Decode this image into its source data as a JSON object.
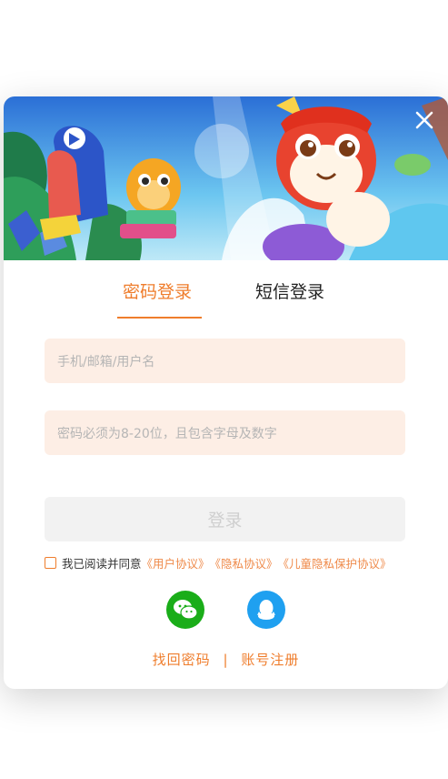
{
  "tabs": [
    {
      "label": "密码登录",
      "active": true
    },
    {
      "label": "短信登录",
      "active": false
    }
  ],
  "fields": {
    "username_placeholder": "手机/邮箱/用户名",
    "password_placeholder": "密码必须为8-20位，且包含字母及数字"
  },
  "login_button": "登录",
  "agreement": {
    "prefix": "我已阅读并同意",
    "user_agreement": "《用户协议》",
    "privacy": "《隐私协议》",
    "child_privacy": "《儿童隐私保护协议》"
  },
  "links": {
    "forgot": "找回密码",
    "separator": "|",
    "register": "账号注册"
  },
  "icons": {
    "close": "close-icon",
    "wechat": "wechat-icon",
    "qq": "qq-icon"
  },
  "colors": {
    "accent": "#ef7d2c",
    "field_bg": "#fdeee5",
    "wechat": "#1aad19",
    "qq": "#1fa0f0"
  }
}
